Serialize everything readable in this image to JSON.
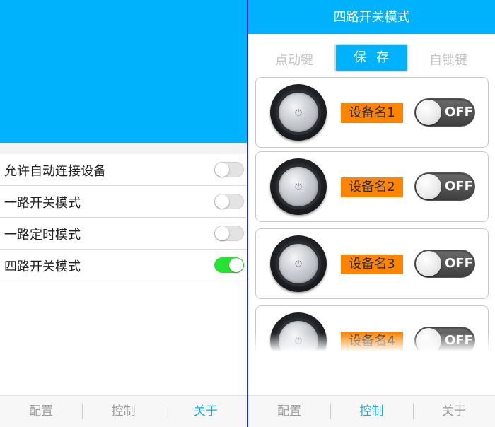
{
  "left_panel": {
    "settings": [
      {
        "label": "允许自动连接设备",
        "enabled": false
      },
      {
        "label": "一路开关模式",
        "enabled": false
      },
      {
        "label": "一路定时模式",
        "enabled": false
      },
      {
        "label": "四路开关模式",
        "enabled": true
      }
    ],
    "tabs": [
      {
        "label": "配置",
        "active": false
      },
      {
        "label": "控制",
        "active": false
      },
      {
        "label": "关于",
        "active": true
      }
    ]
  },
  "right_panel": {
    "title": "四路开关模式",
    "mode_left": "点动键",
    "save_button": "保存",
    "mode_right": "自锁键",
    "devices": [
      {
        "name": "设备名1",
        "state": "OFF"
      },
      {
        "name": "设备名2",
        "state": "OFF"
      },
      {
        "name": "设备名3",
        "state": "OFF"
      },
      {
        "name": "设备名4",
        "state": "OFF"
      }
    ],
    "tabs": [
      {
        "label": "配置",
        "active": false
      },
      {
        "label": "控制",
        "active": true
      },
      {
        "label": "关于",
        "active": false
      }
    ]
  },
  "colors": {
    "brand_blue": "#00b1fb",
    "switch_on_green": "#27e331",
    "device_label_orange": "#ff8500",
    "tab_active": "#13aee9"
  },
  "icons": {
    "device_knob": "power-knob-icon"
  }
}
